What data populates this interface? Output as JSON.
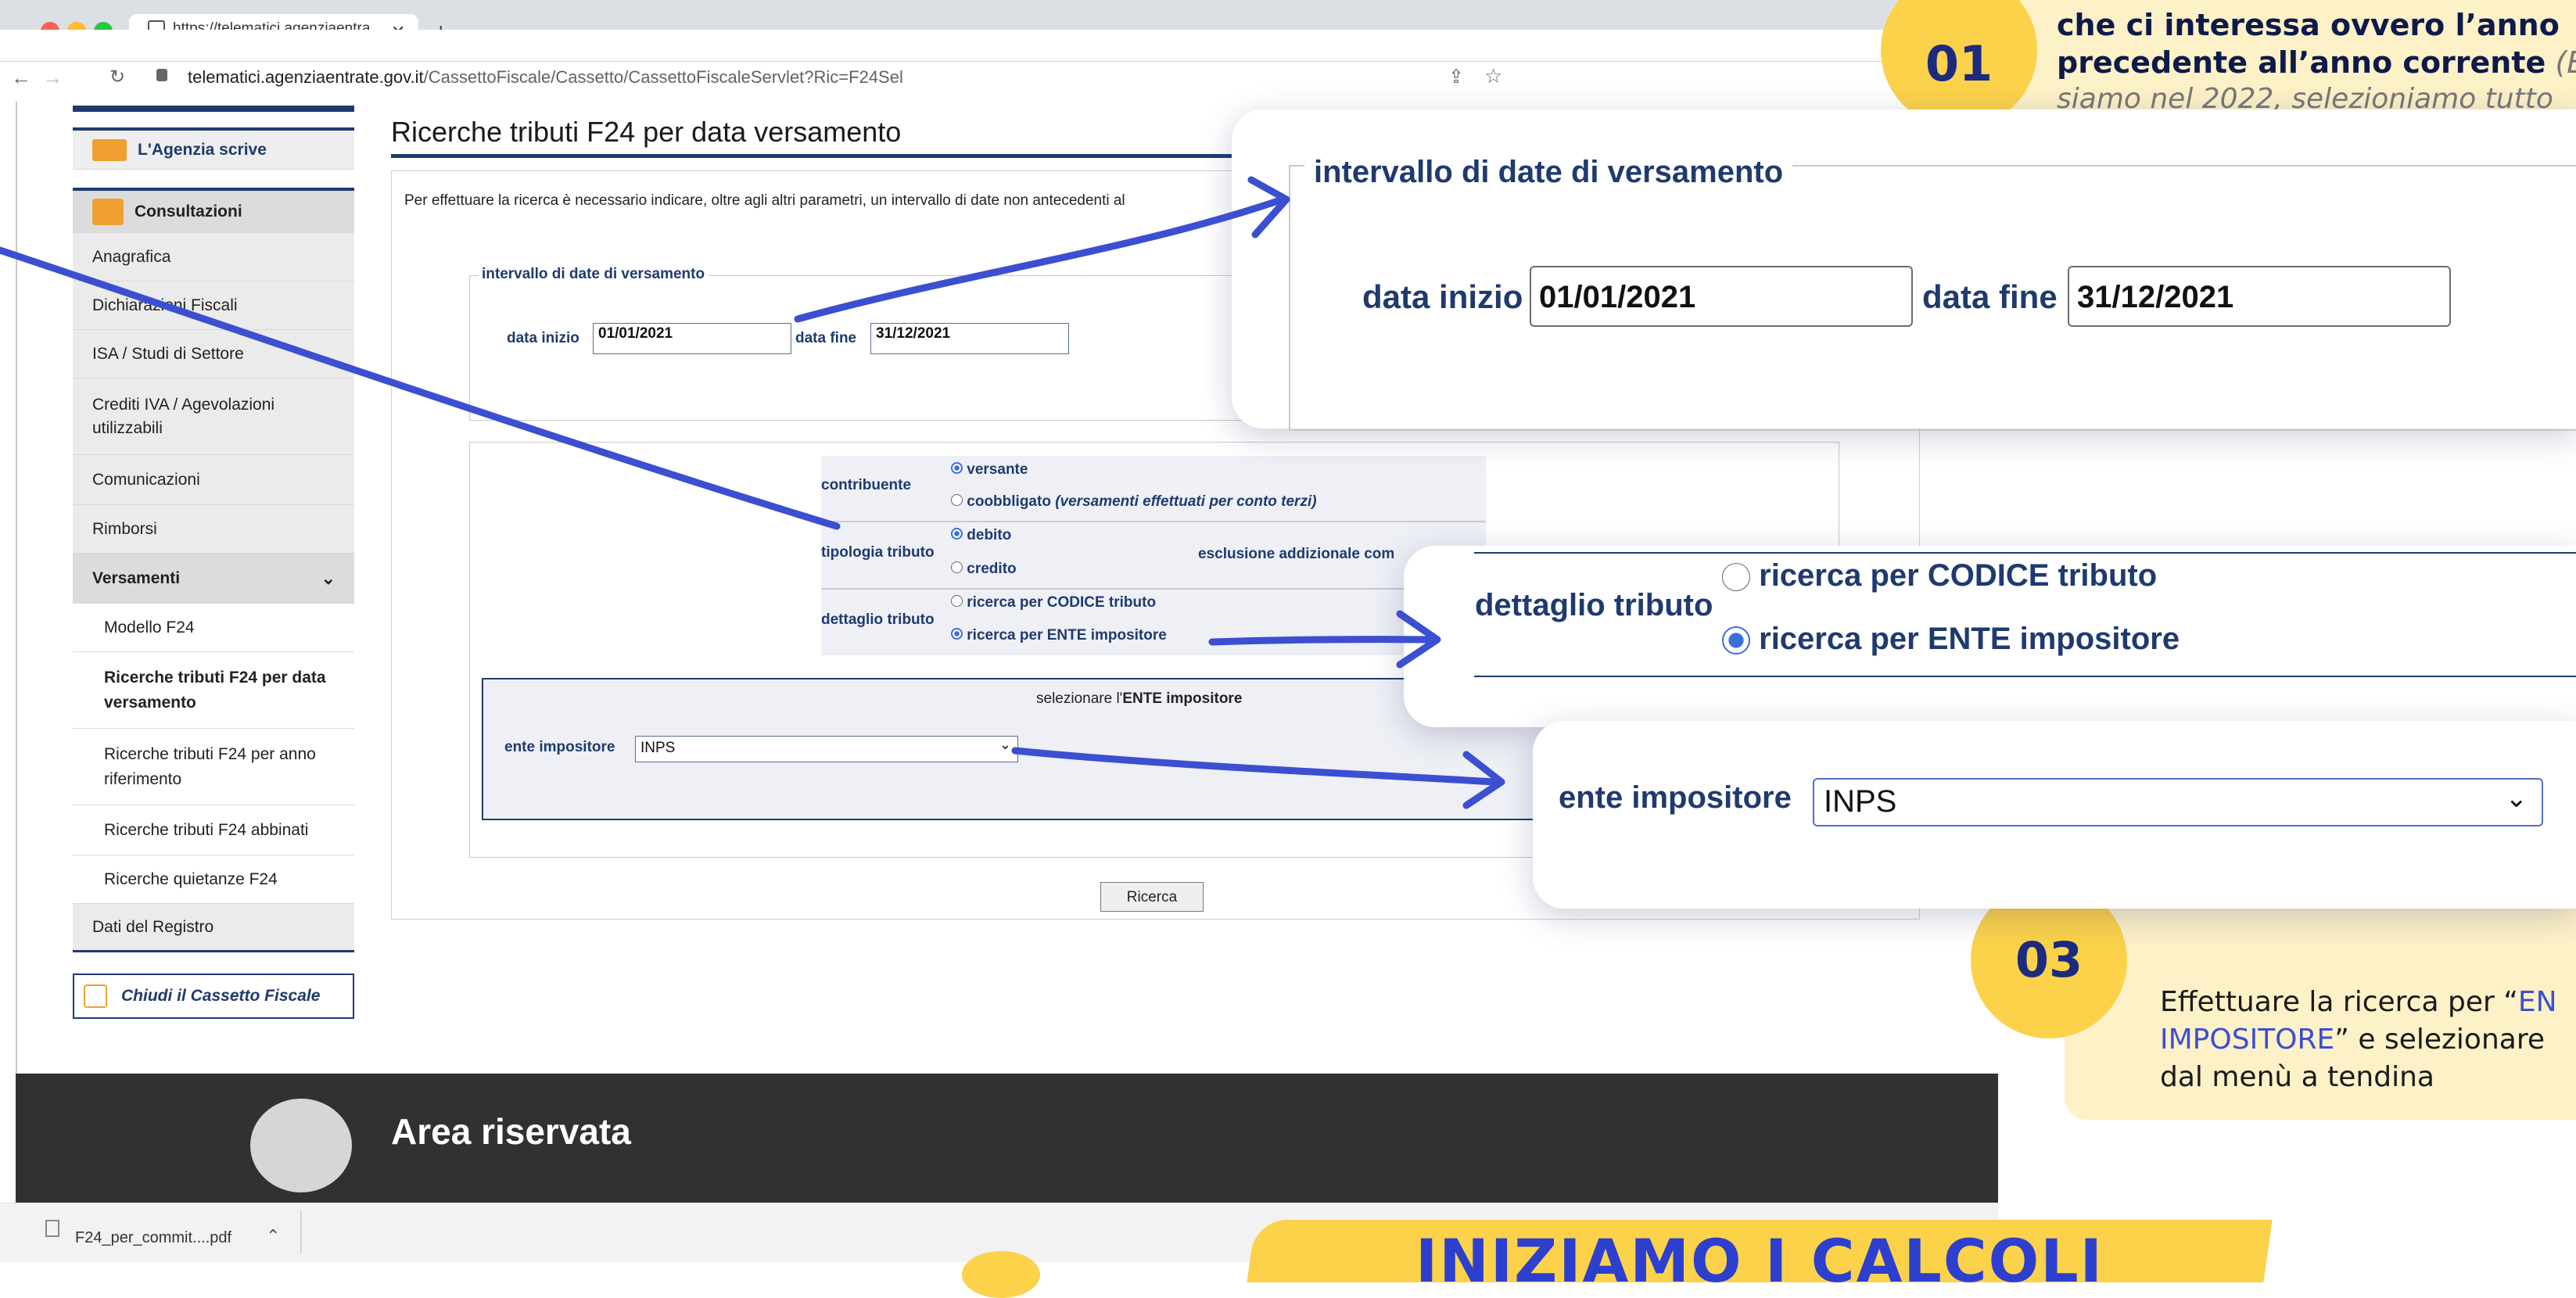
{
  "browser": {
    "tab_title": "https://telematici.agenziaentra",
    "url_host": "telematici.agenziaentrate.gov.it",
    "url_path": "/CassettoFiscale/Cassetto/CassettoFiscaleServlet?Ric=F24Sel"
  },
  "sidebar": {
    "agenzia_scrive": "L'Agenzia scrive",
    "consultazioni": "Consultazioni",
    "items": [
      {
        "label": "Anagrafica"
      },
      {
        "label": "Dichiarazioni Fiscali"
      },
      {
        "label": "ISA / Studi di Settore"
      },
      {
        "label": "Crediti IVA / Agevolazioni utilizzabili"
      },
      {
        "label": "Comunicazioni"
      },
      {
        "label": "Rimborsi"
      },
      {
        "label": "Versamenti"
      },
      {
        "label": "Modello F24"
      },
      {
        "label": "Ricerche tributi F24 per data versamento"
      },
      {
        "label": "Ricerche tributi F24 per anno riferimento"
      },
      {
        "label": "Ricerche tributi F24 abbinati"
      },
      {
        "label": "Ricerche quietanze F24"
      },
      {
        "label": "Dati del Registro"
      }
    ],
    "chiudi": "Chiudi il Cassetto Fiscale"
  },
  "content": {
    "title": "Ricerche tributi F24 per data versamento",
    "intro": "Per effettuare la ricerca è necessario indicare, oltre agli altri parametri, un intervallo di date non antecedenti al",
    "interval_legend": "intervallo di date di versamento",
    "data_inizio_label": "data inizio",
    "data_inizio": "01/01/2021",
    "data_fine_label": "data fine",
    "data_fine": "31/12/2021",
    "contribuente_label": "contribuente",
    "versante": "versante",
    "coobbligato": "coobbligato",
    "coobbligato_note": "(versamenti effettuati per conto terzi)",
    "tipologia_label": "tipologia tributo",
    "debito": "debito",
    "credito": "credito",
    "esclusione": "esclusione addizionale com",
    "dettaglio_label": "dettaglio tributo",
    "codice": "ricerca per CODICE tributo",
    "ente": "ricerca per ENTE impositore",
    "selezionare_prefix": "selezionare l'",
    "selezionare_bold": "ENTE impositore",
    "ente_label": "ente impositore",
    "ente_value": "INPS",
    "ricerca_button": "Ricerca"
  },
  "footer": {
    "area_riservata": "Area riservata",
    "download_file": "F24_per_commit....pdf"
  },
  "overlays": {
    "zoom1_legend": "intervallo di date di versamento",
    "zoom1_inizio_label": "data inizio",
    "zoom1_inizio": "01/01/2021",
    "zoom1_fine_label": "data fine",
    "zoom1_fine": "31/12/2021",
    "zoom2_label": "dettaglio tributo",
    "zoom2_codice": "ricerca per CODICE tributo",
    "zoom2_ente": "ricerca per ENTE impositore",
    "zoom3_label": "ente impositore",
    "zoom3_value": "INPS",
    "badge1": "01",
    "badge1_line1": "che ci interessa ovvero l’anno",
    "badge1_line2": "precedente all’anno corrente",
    "badge1_line2_italic": "(Es",
    "badge1_line3": "siamo nel 2022, selezioniamo tutto",
    "badge3": "03",
    "badge3_text_a": "Effettuare la ricerca per “",
    "badge3_text_hl1": "EN",
    "badge3_text_hl2": "IMPOSITORE",
    "badge3_text_b": "” e  selezionare",
    "badge3_text_c": "dal menù a tendina",
    "banner": "INIZIAMO I CALCOLI"
  },
  "colors": {
    "navy": "#1f3a6e",
    "arrow": "#3b4fd1",
    "badge": "#fbd24a",
    "note_bg": "#fdf1c7",
    "footer": "#2f3133"
  }
}
